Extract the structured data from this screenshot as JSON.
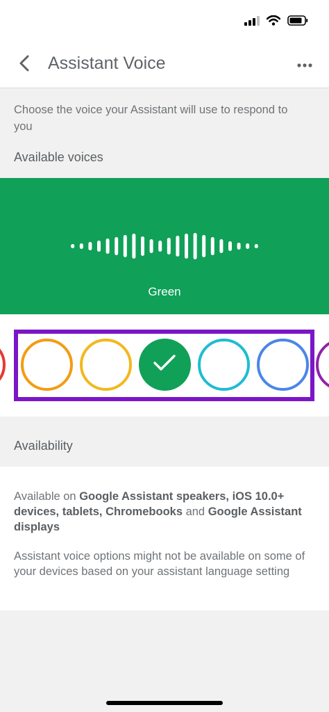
{
  "status_bar": {
    "icons": [
      "signal-icon",
      "wifi-icon",
      "battery-icon"
    ]
  },
  "header": {
    "title": "Assistant Voice",
    "back_icon": "chevron-left-icon",
    "more_icon": "more-horizontal-icon"
  },
  "description": "Choose the voice your Assistant will use to respond to you",
  "voices_section": {
    "label": "Available voices",
    "selected_voice": "Green",
    "panel_color": "#10a058",
    "swatches": [
      {
        "color": "#e53935",
        "selected": false
      },
      {
        "color": "#f39c12",
        "selected": false
      },
      {
        "color": "#f2b81e",
        "selected": false
      },
      {
        "color": "#10a058",
        "selected": true
      },
      {
        "color": "#1fbcd2",
        "selected": false
      },
      {
        "color": "#4a86e8",
        "selected": false
      },
      {
        "color": "#8e24aa",
        "selected": false
      }
    ],
    "highlight_color": "#7a16c8"
  },
  "availability": {
    "label": "Availability",
    "paragraph1": {
      "prefix": "Available on ",
      "devices": "Google Assistant speakers, iOS 10.0+ devices, tablets, Chromebooks",
      "joiner": " and ",
      "last": "Google Assistant displays"
    },
    "paragraph2": "Assistant voice options might not be available on some of your devices based on your assistant language setting"
  }
}
